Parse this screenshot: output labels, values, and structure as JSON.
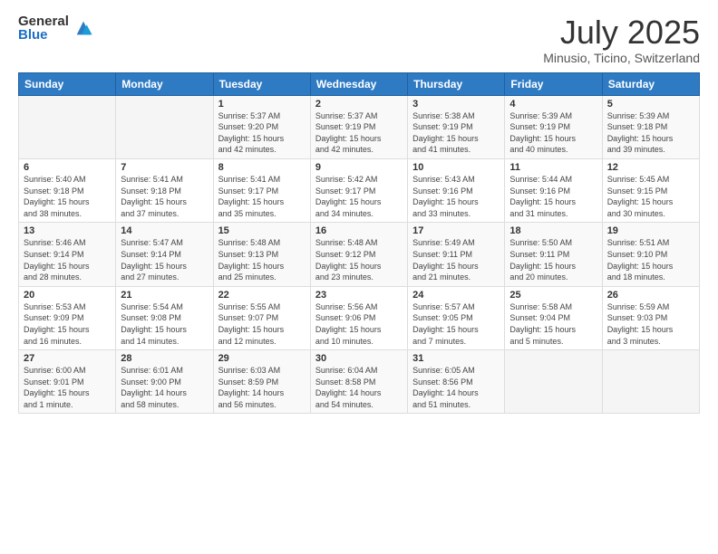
{
  "logo": {
    "general": "General",
    "blue": "Blue"
  },
  "title": "July 2025",
  "location": "Minusio, Ticino, Switzerland",
  "days_of_week": [
    "Sunday",
    "Monday",
    "Tuesday",
    "Wednesday",
    "Thursday",
    "Friday",
    "Saturday"
  ],
  "weeks": [
    [
      {
        "day": "",
        "info": ""
      },
      {
        "day": "",
        "info": ""
      },
      {
        "day": "1",
        "info": "Sunrise: 5:37 AM\nSunset: 9:20 PM\nDaylight: 15 hours\nand 42 minutes."
      },
      {
        "day": "2",
        "info": "Sunrise: 5:37 AM\nSunset: 9:19 PM\nDaylight: 15 hours\nand 42 minutes."
      },
      {
        "day": "3",
        "info": "Sunrise: 5:38 AM\nSunset: 9:19 PM\nDaylight: 15 hours\nand 41 minutes."
      },
      {
        "day": "4",
        "info": "Sunrise: 5:39 AM\nSunset: 9:19 PM\nDaylight: 15 hours\nand 40 minutes."
      },
      {
        "day": "5",
        "info": "Sunrise: 5:39 AM\nSunset: 9:18 PM\nDaylight: 15 hours\nand 39 minutes."
      }
    ],
    [
      {
        "day": "6",
        "info": "Sunrise: 5:40 AM\nSunset: 9:18 PM\nDaylight: 15 hours\nand 38 minutes."
      },
      {
        "day": "7",
        "info": "Sunrise: 5:41 AM\nSunset: 9:18 PM\nDaylight: 15 hours\nand 37 minutes."
      },
      {
        "day": "8",
        "info": "Sunrise: 5:41 AM\nSunset: 9:17 PM\nDaylight: 15 hours\nand 35 minutes."
      },
      {
        "day": "9",
        "info": "Sunrise: 5:42 AM\nSunset: 9:17 PM\nDaylight: 15 hours\nand 34 minutes."
      },
      {
        "day": "10",
        "info": "Sunrise: 5:43 AM\nSunset: 9:16 PM\nDaylight: 15 hours\nand 33 minutes."
      },
      {
        "day": "11",
        "info": "Sunrise: 5:44 AM\nSunset: 9:16 PM\nDaylight: 15 hours\nand 31 minutes."
      },
      {
        "day": "12",
        "info": "Sunrise: 5:45 AM\nSunset: 9:15 PM\nDaylight: 15 hours\nand 30 minutes."
      }
    ],
    [
      {
        "day": "13",
        "info": "Sunrise: 5:46 AM\nSunset: 9:14 PM\nDaylight: 15 hours\nand 28 minutes."
      },
      {
        "day": "14",
        "info": "Sunrise: 5:47 AM\nSunset: 9:14 PM\nDaylight: 15 hours\nand 27 minutes."
      },
      {
        "day": "15",
        "info": "Sunrise: 5:48 AM\nSunset: 9:13 PM\nDaylight: 15 hours\nand 25 minutes."
      },
      {
        "day": "16",
        "info": "Sunrise: 5:48 AM\nSunset: 9:12 PM\nDaylight: 15 hours\nand 23 minutes."
      },
      {
        "day": "17",
        "info": "Sunrise: 5:49 AM\nSunset: 9:11 PM\nDaylight: 15 hours\nand 21 minutes."
      },
      {
        "day": "18",
        "info": "Sunrise: 5:50 AM\nSunset: 9:11 PM\nDaylight: 15 hours\nand 20 minutes."
      },
      {
        "day": "19",
        "info": "Sunrise: 5:51 AM\nSunset: 9:10 PM\nDaylight: 15 hours\nand 18 minutes."
      }
    ],
    [
      {
        "day": "20",
        "info": "Sunrise: 5:53 AM\nSunset: 9:09 PM\nDaylight: 15 hours\nand 16 minutes."
      },
      {
        "day": "21",
        "info": "Sunrise: 5:54 AM\nSunset: 9:08 PM\nDaylight: 15 hours\nand 14 minutes."
      },
      {
        "day": "22",
        "info": "Sunrise: 5:55 AM\nSunset: 9:07 PM\nDaylight: 15 hours\nand 12 minutes."
      },
      {
        "day": "23",
        "info": "Sunrise: 5:56 AM\nSunset: 9:06 PM\nDaylight: 15 hours\nand 10 minutes."
      },
      {
        "day": "24",
        "info": "Sunrise: 5:57 AM\nSunset: 9:05 PM\nDaylight: 15 hours\nand 7 minutes."
      },
      {
        "day": "25",
        "info": "Sunrise: 5:58 AM\nSunset: 9:04 PM\nDaylight: 15 hours\nand 5 minutes."
      },
      {
        "day": "26",
        "info": "Sunrise: 5:59 AM\nSunset: 9:03 PM\nDaylight: 15 hours\nand 3 minutes."
      }
    ],
    [
      {
        "day": "27",
        "info": "Sunrise: 6:00 AM\nSunset: 9:01 PM\nDaylight: 15 hours\nand 1 minute."
      },
      {
        "day": "28",
        "info": "Sunrise: 6:01 AM\nSunset: 9:00 PM\nDaylight: 14 hours\nand 58 minutes."
      },
      {
        "day": "29",
        "info": "Sunrise: 6:03 AM\nSunset: 8:59 PM\nDaylight: 14 hours\nand 56 minutes."
      },
      {
        "day": "30",
        "info": "Sunrise: 6:04 AM\nSunset: 8:58 PM\nDaylight: 14 hours\nand 54 minutes."
      },
      {
        "day": "31",
        "info": "Sunrise: 6:05 AM\nSunset: 8:56 PM\nDaylight: 14 hours\nand 51 minutes."
      },
      {
        "day": "",
        "info": ""
      },
      {
        "day": "",
        "info": ""
      }
    ]
  ]
}
